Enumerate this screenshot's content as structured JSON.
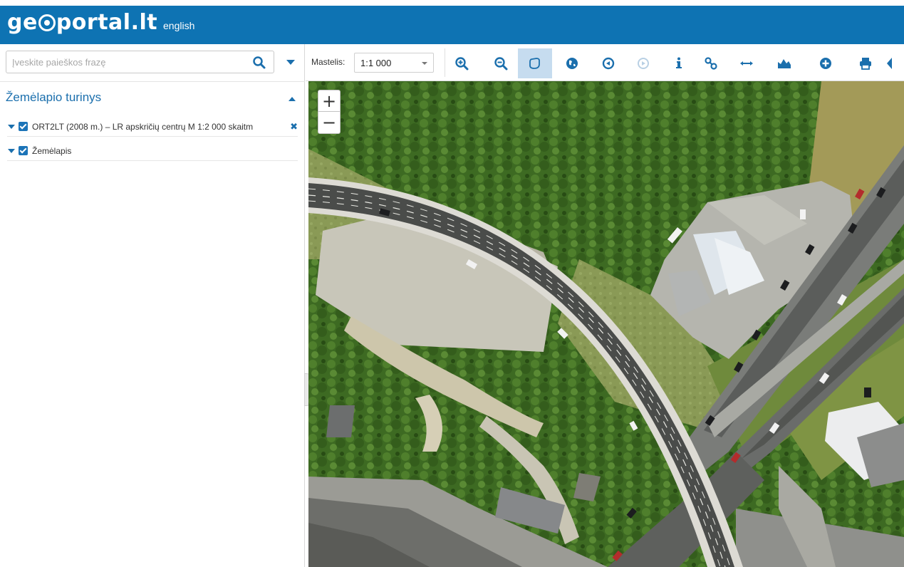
{
  "header": {
    "logo": "geoportal.lt",
    "logo_prefix": "ge",
    "logo_suffix": "portal.lt",
    "language": "english",
    "bg_color": "#0e73b3"
  },
  "sidebar": {
    "search": {
      "placeholder": "Įveskite paieškos frazę",
      "value": ""
    },
    "panel_title": "Žemėlapio turinys",
    "layers": [
      {
        "label": "ORT2LT (2008 m.) – LR apskričių centrų M 1:2 000 skaitm",
        "checked": true,
        "removable": true
      },
      {
        "label": "Žemėlapis",
        "checked": true,
        "removable": false
      }
    ]
  },
  "toolbar": {
    "scale_label": "Mastelis:",
    "scale_value": "1:1 000",
    "tools": [
      {
        "name": "zoom-in-tool-icon",
        "active": false
      },
      {
        "name": "zoom-out-tool-icon",
        "active": false
      },
      {
        "name": "pan-tool-icon",
        "active": true
      },
      {
        "name": "globe-icon",
        "active": false
      },
      {
        "name": "previous-extent-icon",
        "active": false
      },
      {
        "name": "next-extent-icon",
        "active": false,
        "disabled": true
      },
      {
        "name": "info-icon",
        "active": false
      },
      {
        "name": "link-icon",
        "active": false
      },
      {
        "name": "measure-distance-icon",
        "active": false
      },
      {
        "name": "elevation-profile-icon",
        "active": false
      },
      {
        "name": "add-layer-icon",
        "active": false
      },
      {
        "name": "print-icon",
        "active": false
      },
      {
        "name": "more-icon",
        "active": false
      }
    ],
    "accent_color": "#1b6fad"
  },
  "map": {
    "zoom_in": "+",
    "zoom_out": "−"
  }
}
